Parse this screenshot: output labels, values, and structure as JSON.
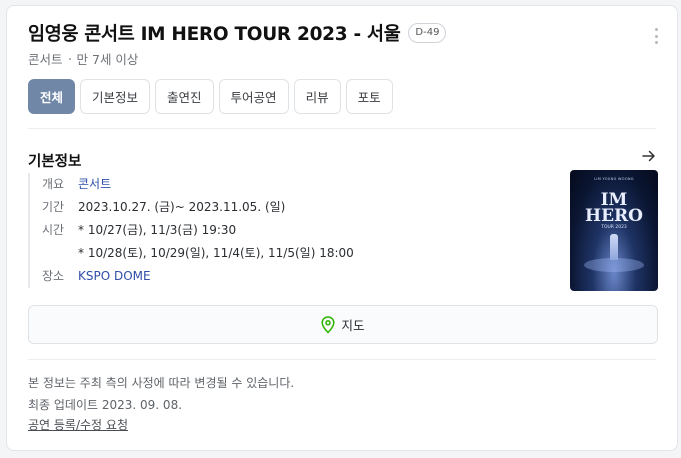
{
  "header": {
    "title": "임영웅 콘서트 IM HERO TOUR 2023 - 서울",
    "dday_badge": "D-49",
    "category": "콘서트",
    "age_limit": "만 7세 이상"
  },
  "tabs": [
    {
      "label": "전체",
      "active": true
    },
    {
      "label": "기본정보",
      "active": false
    },
    {
      "label": "출연진",
      "active": false
    },
    {
      "label": "투어공연",
      "active": false
    },
    {
      "label": "리뷰",
      "active": false
    },
    {
      "label": "포토",
      "active": false
    }
  ],
  "basic_info": {
    "section_title": "기본정보",
    "overview_label": "개요",
    "overview_value": "콘서트",
    "period_label": "기간",
    "period_value": "2023.10.27. (금)~ 2023.11.05. (일)",
    "time_label": "시간",
    "time_line1": "* 10/27(금), 11/3(금) 19:30",
    "time_line2": "* 10/28(토), 10/29(일), 11/4(토), 11/5(일) 18:00",
    "venue_label": "장소",
    "venue_value": "KSPO DOME"
  },
  "poster": {
    "top_text": "LIM YOUNG WOONG",
    "main_text_line1": "IM",
    "main_text_line2": "HERO",
    "tour_text": "TOUR 2023"
  },
  "map_button": {
    "label": "지도",
    "icon": "map-pin-icon"
  },
  "footer": {
    "notice": "본 정보는 주최 측의 사정에 따라 변경될 수 있습니다.",
    "updated": "최종 업데이트 2023. 09. 08.",
    "report_link": "공연 등록/수정 요청"
  },
  "colors": {
    "accent_tab": "#7187a8",
    "link": "#2f4fa8",
    "map_pin": "#2db400"
  }
}
